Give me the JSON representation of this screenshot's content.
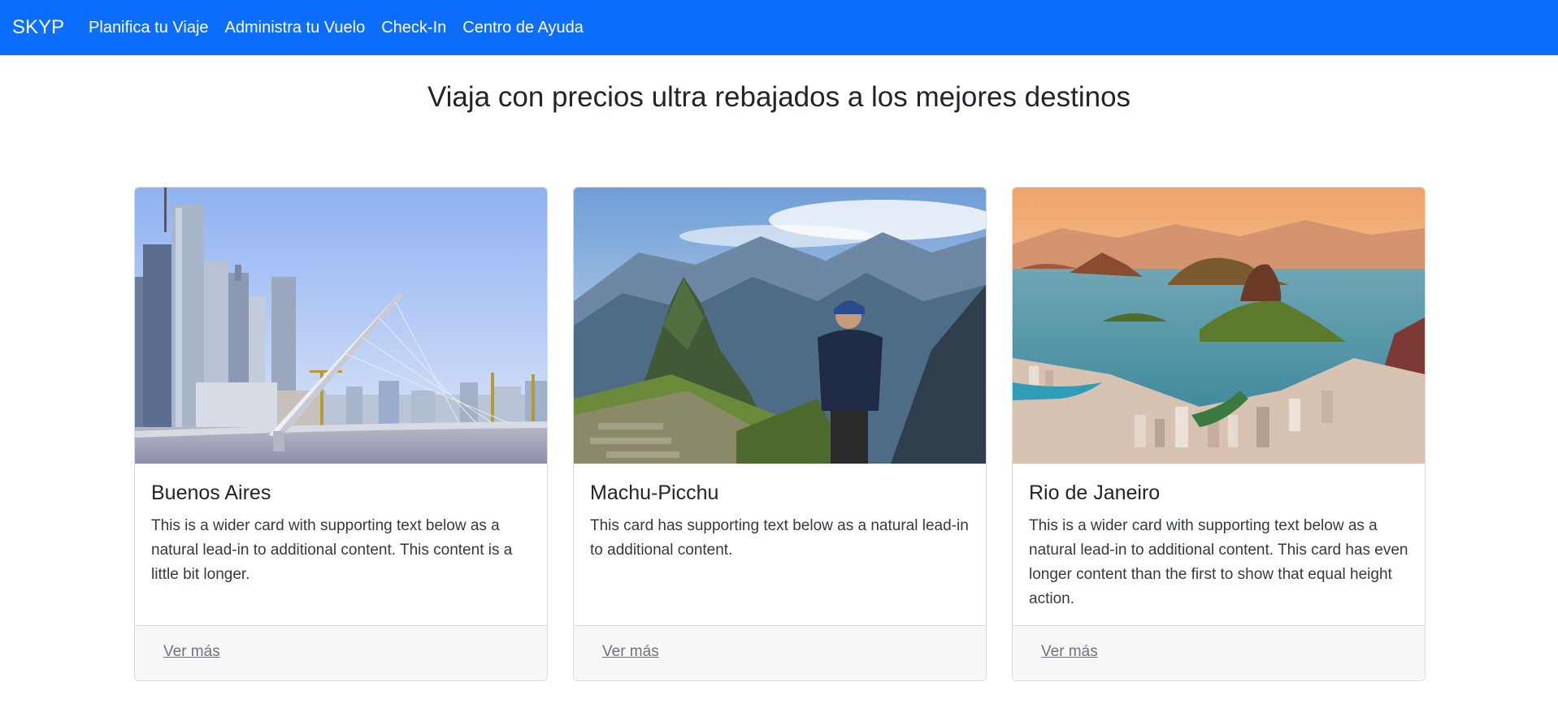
{
  "navbar": {
    "brand": "SKYP",
    "links": [
      "Planifica tu Viaje",
      "Administra tu Vuelo",
      "Check-In",
      "Centro de Ayuda"
    ],
    "color": "#0d6efd"
  },
  "headline": "Viaja con precios ultra rebajados a los mejores destinos",
  "cards": [
    {
      "title": "Buenos Aires",
      "text": "This is a wider card with supporting text below as a natural lead-in to additional content. This content is a little bit longer.",
      "link": "Ver más",
      "image": "buenos-aires-skyline-bridge"
    },
    {
      "title": "Machu-Picchu",
      "text": "This card has supporting text below as a natural lead-in to additional content.",
      "link": "Ver más",
      "image": "machu-picchu-hiker"
    },
    {
      "title": "Rio de Janeiro",
      "text": "This is a wider card with supporting text below as a natural lead-in to additional content. This card has even longer content than the first to show that equal height action.",
      "link": "Ver más",
      "image": "rio-de-janeiro-bay"
    }
  ]
}
